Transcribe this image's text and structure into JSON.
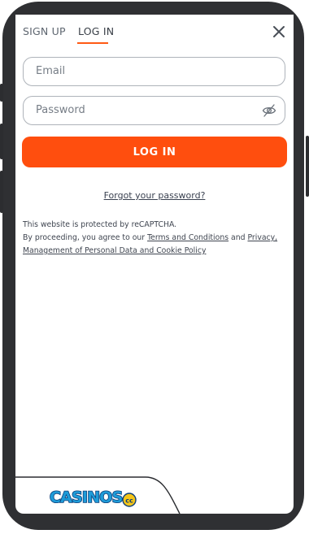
{
  "tabs": {
    "signup": "SIGN UP",
    "login": "LOG IN"
  },
  "form": {
    "email_placeholder": "Email",
    "password_placeholder": "Password",
    "submit_label": "LOG IN",
    "forgot_label": "Forgot your password?"
  },
  "legal": {
    "line1": "This website is protected by reCAPTCHA.",
    "line2_prefix": "By proceeding, you agree to our ",
    "terms_link": "Terms and Conditions",
    "and_text": " and ",
    "privacy_link_1": "Privacy,",
    "privacy_link_2": "Management of Personal Data and Cookie Policy"
  },
  "logo": {
    "text": "CASINOS",
    "suffix": "cc"
  },
  "colors": {
    "accent": "#ff4e0e",
    "frame": "#2f3033"
  },
  "icons": {
    "close": "close-icon",
    "password_toggle": "eye-off-icon"
  }
}
